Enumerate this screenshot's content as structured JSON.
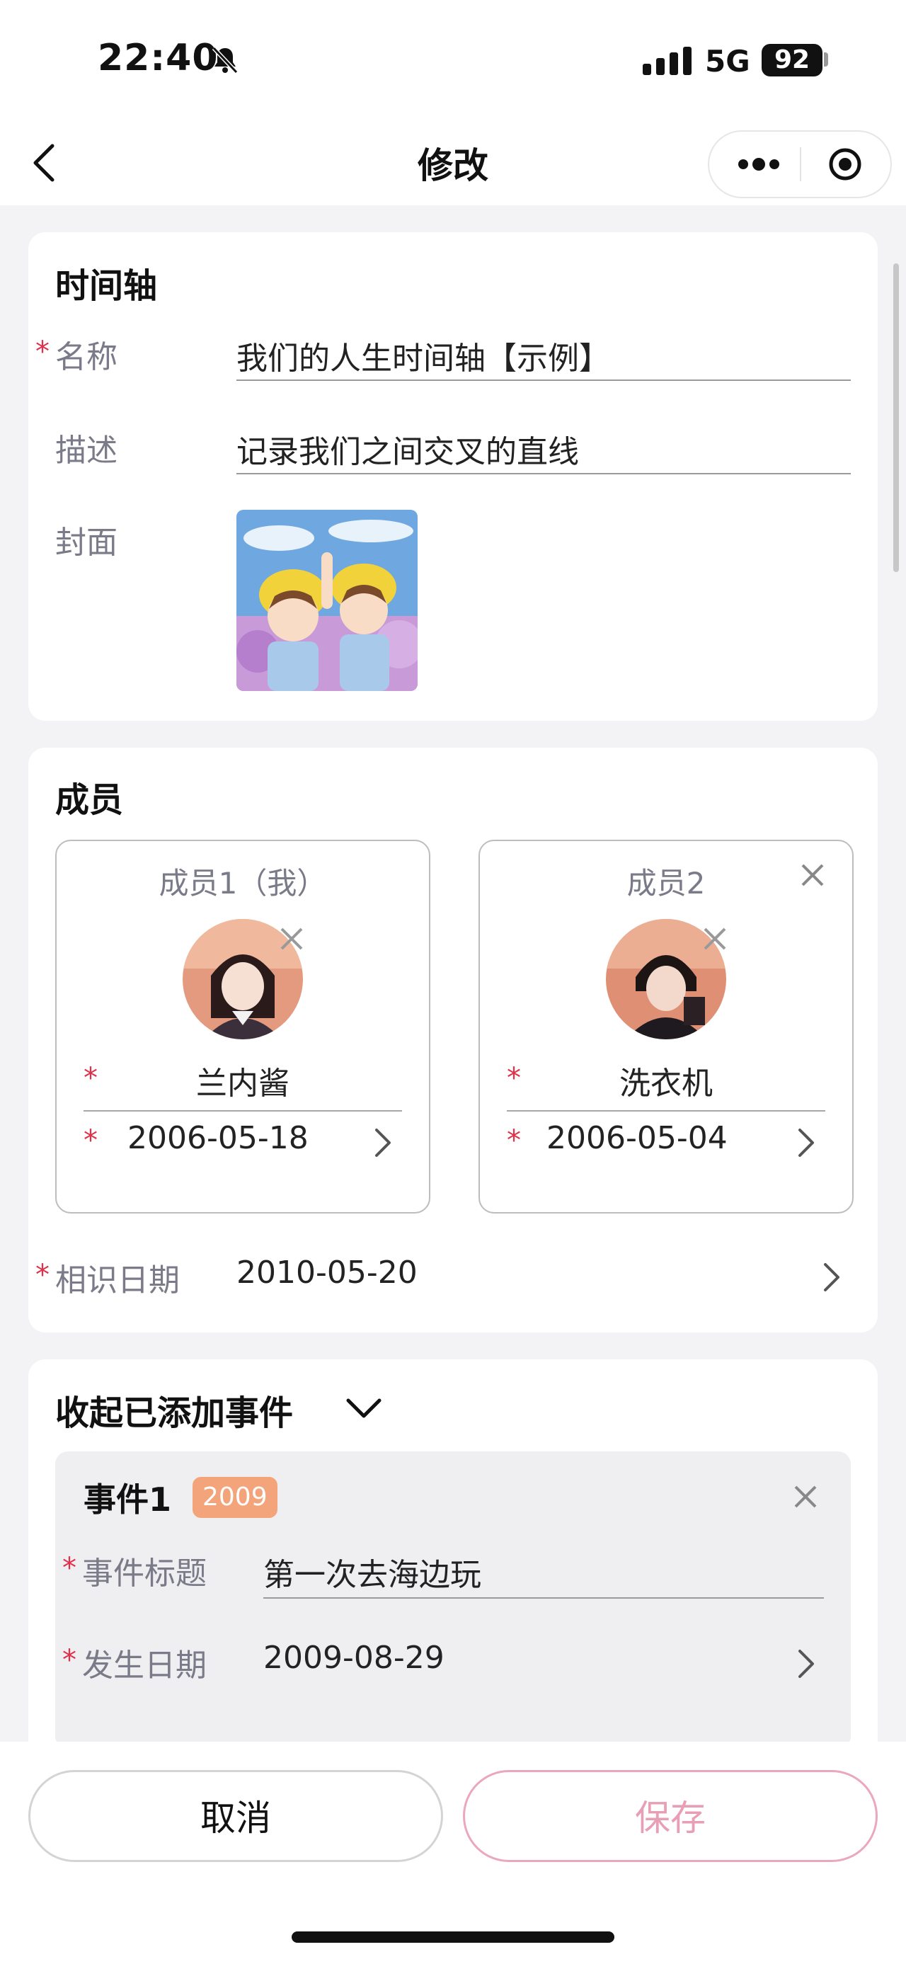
{
  "status_bar": {
    "time": "22:40",
    "network": "5G",
    "battery": "92"
  },
  "nav": {
    "title": "修改"
  },
  "timeline": {
    "section_title": "时间轴",
    "name_label": "名称",
    "name_value": "我们的人生时间轴【示例】",
    "desc_label": "描述",
    "desc_value": "记录我们之间交叉的直线",
    "cover_label": "封面"
  },
  "members": {
    "section_title": "成员",
    "items": [
      {
        "title": "成员1（我）",
        "name": "兰内酱",
        "birthday": "2006-05-18"
      },
      {
        "title": "成员2",
        "name": "洗衣机",
        "birthday": "2006-05-04"
      }
    ],
    "meet_label": "相识日期",
    "meet_value": "2010-05-20"
  },
  "events": {
    "toggle_label": "收起已添加事件",
    "items": [
      {
        "title": "事件1",
        "year_badge": "2009",
        "title_label": "事件标题",
        "title_value": "第一次去海边玩",
        "date_label": "发生日期",
        "date_value": "2009-08-29"
      }
    ]
  },
  "actions": {
    "cancel": "取消",
    "save": "保存"
  },
  "colors": {
    "required": "#e0304a",
    "badge": "#f4a47a",
    "save": "#e89fb6"
  }
}
